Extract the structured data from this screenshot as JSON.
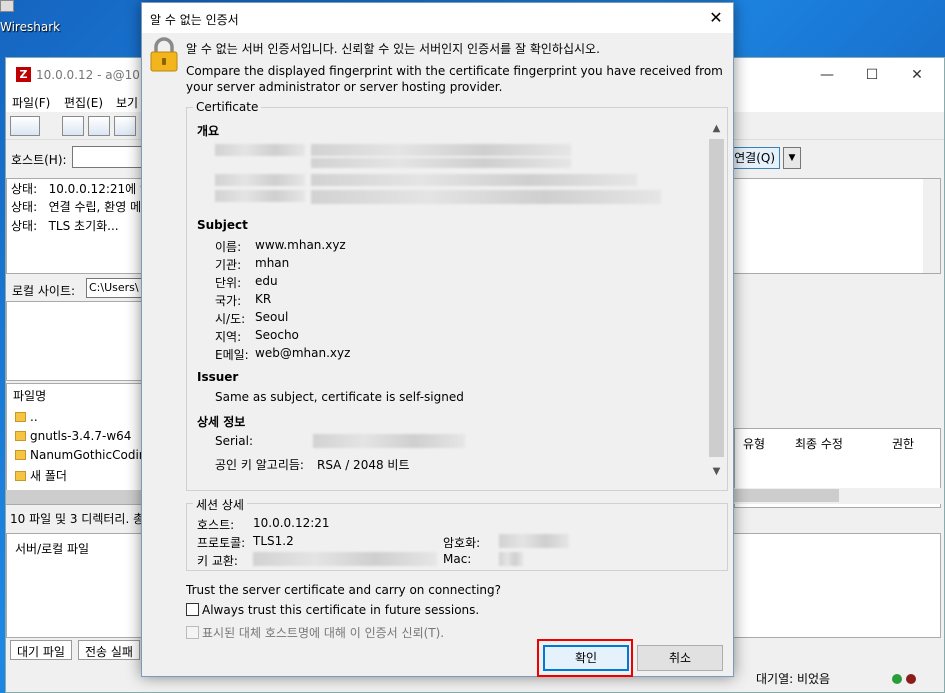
{
  "desktop": {
    "icon_label": "Wireshark"
  },
  "filezilla": {
    "title": "10.0.0.12 - a@10.0",
    "menu": [
      "파일(F)",
      "편집(E)",
      "보기"
    ],
    "host_label": "호스트(H):",
    "connect_label": "연결(Q)",
    "log": [
      {
        "label": "상태:",
        "text": "10.0.0.12:21에 연"
      },
      {
        "label": "상태:",
        "text": "연결 수립, 환영 메"
      },
      {
        "label": "상태:",
        "text": "TLS 초기화..."
      }
    ],
    "local_site_label": "로컬 사이트:",
    "local_site_value": "C:\\Users\\",
    "file_column": "파일명",
    "files": [
      "..",
      "gnutls-3.4.7-w64",
      "NanumGothicCoding",
      "새 폴더"
    ],
    "local_status": "10 파일 및 3 디렉터리. 총",
    "remote_columns": [
      "유형",
      "최종 수정",
      "권한"
    ],
    "queue_header": "서버/로컬 파일",
    "queue_tabs": [
      "대기 파일",
      "전송 실패"
    ],
    "queue_status": "대기열: 비었음"
  },
  "dialog": {
    "title": "알 수 없는 인증서",
    "heading": "알 수 없는 서버 인증서입니다. 신뢰할 수 있는 서버인지 인증서를 잘 확인하십시오.",
    "description": "Compare the displayed fingerprint with the certificate fingerprint you have received from your server administrator or server hosting provider.",
    "certificate_legend": "Certificate",
    "overview_title": "개요",
    "subject_title": "Subject",
    "subject": [
      {
        "label": "이름:",
        "value": "www.mhan.xyz"
      },
      {
        "label": "기관:",
        "value": "mhan"
      },
      {
        "label": "단위:",
        "value": "edu"
      },
      {
        "label": "국가:",
        "value": "KR"
      },
      {
        "label": "시/도:",
        "value": "Seoul"
      },
      {
        "label": "지역:",
        "value": "Seocho"
      },
      {
        "label": "E메일:",
        "value": "web@mhan.xyz"
      }
    ],
    "issuer_title": "Issuer",
    "issuer_text": "Same as subject, certificate is self-signed",
    "details_title": "상세 정보",
    "serial_label": "Serial:",
    "pubkey_label": "공인 키 알고리듬:",
    "pubkey_value": "RSA / 2048 비트",
    "session_legend": "세션 상세",
    "host_label": "호스트:",
    "host_value": "10.0.0.12:21",
    "protocol_label": "프로토콜:",
    "protocol_value": "TLS1.2",
    "kex_label": "키 교환:",
    "cipher_label": "암호화:",
    "mac_label": "Mac:",
    "trust_question": "Trust the server certificate and carry on connecting?",
    "always_trust": "Always trust this certificate in future sessions.",
    "trust_alt_host": "표시된 대체 호스트명에 대해 이 인증서 신뢰(T).",
    "ok_label": "확인",
    "cancel_label": "취소"
  }
}
